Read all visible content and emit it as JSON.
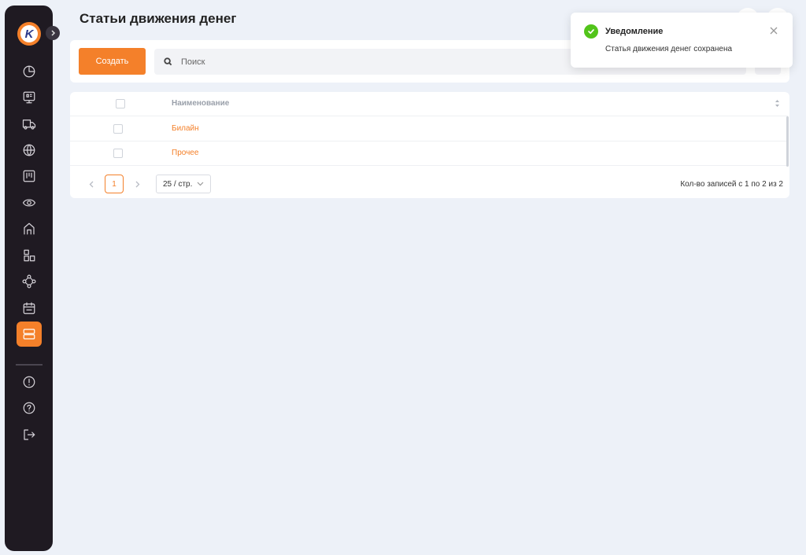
{
  "page": {
    "title": "Статьи движения денег"
  },
  "sidebar": {
    "logo_letter": "K",
    "items": [
      {
        "icon": "dashboard-icon",
        "active": false
      },
      {
        "icon": "monitor-icon",
        "active": false
      },
      {
        "icon": "truck-icon",
        "active": false
      },
      {
        "icon": "globe-icon",
        "active": false
      },
      {
        "icon": "board-icon",
        "active": false
      },
      {
        "icon": "eye-icon",
        "active": false
      },
      {
        "icon": "home-icon",
        "active": false
      },
      {
        "icon": "warehouse-icon",
        "active": false
      },
      {
        "icon": "network-icon",
        "active": false
      },
      {
        "icon": "calendar-icon",
        "active": false
      },
      {
        "icon": "server-icon",
        "active": true
      },
      {
        "icon": "alert-icon",
        "active": false
      },
      {
        "icon": "help-icon",
        "active": false
      },
      {
        "icon": "logout-icon",
        "active": false
      }
    ]
  },
  "toolbar": {
    "create_label": "Создать",
    "search_placeholder": "Поиск"
  },
  "table": {
    "header_name": "Наименование",
    "rows": [
      {
        "name": "Билайн"
      },
      {
        "name": "Прочее"
      }
    ]
  },
  "pagination": {
    "current_page": "1",
    "page_size": "25 / стр.",
    "total_text": "Кол-во записей с 1 по 2 из 2"
  },
  "notification": {
    "title": "Уведомление",
    "message": "Статья движения денег сохранена"
  },
  "colors": {
    "accent": "#f4802a",
    "sidebar_bg": "#1f1a22",
    "background": "#edf1f8",
    "success": "#52c41a"
  }
}
